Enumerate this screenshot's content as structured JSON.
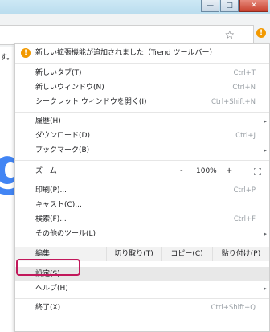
{
  "window": {
    "minimize_glyph": "—",
    "maximize_glyph": "□",
    "close_glyph": "✕"
  },
  "page": {
    "partial_text": "す。",
    "logo_letter": "g"
  },
  "toolbar": {
    "star_glyph": "☆",
    "alert_glyph": "!"
  },
  "menu": {
    "notice": "新しい拡張機能が追加されました（Trend ツールバー）",
    "new_tab": {
      "label": "新しいタブ(T)",
      "shortcut": "Ctrl+T"
    },
    "new_window": {
      "label": "新しいウィンドウ(N)",
      "shortcut": "Ctrl+N"
    },
    "incognito": {
      "label": "シークレット ウィンドウを開く(I)",
      "shortcut": "Ctrl+Shift+N"
    },
    "history": {
      "label": "履歴(H)"
    },
    "downloads": {
      "label": "ダウンロード(D)",
      "shortcut": "Ctrl+J"
    },
    "bookmarks": {
      "label": "ブックマーク(B)"
    },
    "zoom": {
      "label": "ズーム",
      "minus": "-",
      "value": "100%",
      "plus": "+"
    },
    "print": {
      "label": "印刷(P)...",
      "shortcut": "Ctrl+P"
    },
    "cast": {
      "label": "キャスト(C)..."
    },
    "find": {
      "label": "検索(F)...",
      "shortcut": "Ctrl+F"
    },
    "more_tools": {
      "label": "その他のツール(L)"
    },
    "edit": {
      "label": "編集",
      "cut": "切り取り(T)",
      "copy": "コピー(C)",
      "paste": "貼り付け(P)"
    },
    "settings": {
      "label": "設定(S)"
    },
    "help": {
      "label": "ヘルプ(H)"
    },
    "exit": {
      "label": "終了(X)",
      "shortcut": "Ctrl+Shift+Q"
    },
    "arrow_glyph": "▸"
  },
  "colors": {
    "alert": "#f29900",
    "highlight_box": "#c2185b",
    "logo_blue": "#4285f4"
  }
}
